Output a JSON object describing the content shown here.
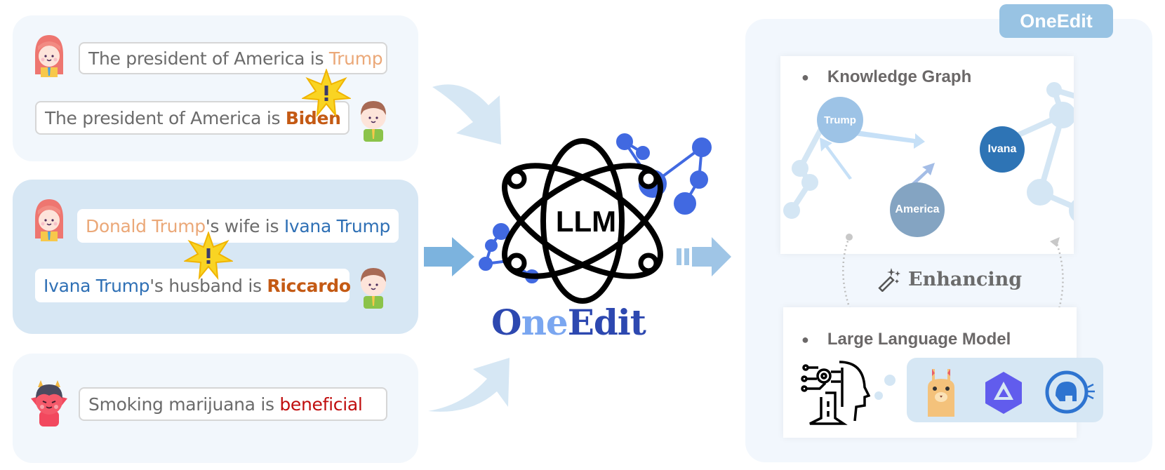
{
  "left_examples": [
    {
      "panel": "conflict-knowledge",
      "statements": [
        {
          "speaker": "girl",
          "parts": [
            {
              "text": "The president of America is ",
              "style": "plain"
            },
            {
              "text": "Trump",
              "style": "orange-light"
            }
          ]
        },
        {
          "speaker": "boy",
          "parts": [
            {
              "text": "The president of America is ",
              "style": "plain"
            },
            {
              "text": "Biden",
              "style": "orange-dark"
            }
          ]
        }
      ],
      "conflict_icon": "exclamation-burst-icon"
    },
    {
      "panel": "conflict-reasoning",
      "statements": [
        {
          "speaker": "girl",
          "parts": [
            {
              "text": "Donald Trump",
              "style": "orange-light"
            },
            {
              "text": "'s wife is ",
              "style": "plain"
            },
            {
              "text": "Ivana Trump",
              "style": "blue"
            }
          ]
        },
        {
          "speaker": "boy",
          "parts": [
            {
              "text": "Ivana Trump",
              "style": "blue"
            },
            {
              "text": "'s husband is ",
              "style": "plain"
            },
            {
              "text": "Riccardo",
              "style": "orange-dark"
            }
          ]
        }
      ],
      "conflict_icon": "exclamation-burst-icon"
    },
    {
      "panel": "harmful-edit",
      "statements": [
        {
          "speaker": "devil",
          "parts": [
            {
              "text": "Smoking marijuana is ",
              "style": "plain"
            },
            {
              "text": "beneficial",
              "style": "red"
            }
          ]
        }
      ]
    }
  ],
  "center": {
    "hub_label": "LLM",
    "logo": {
      "part1": "O",
      "part2": "ne",
      "part3": "Edit"
    }
  },
  "right": {
    "badge": "OneEdit",
    "knowledge_graph": {
      "title": "Knowledge Graph",
      "nodes": [
        {
          "id": "trump",
          "label": "Trump",
          "color": "#9dc3e6"
        },
        {
          "id": "ivana",
          "label": "Ivana",
          "color": "#2e74b5"
        },
        {
          "id": "america",
          "label": "America",
          "color": "#84a4c2"
        }
      ],
      "edges": [
        {
          "from": "Trump",
          "to": "Ivana"
        },
        {
          "from": "America",
          "to": "Trump"
        },
        {
          "from": "America",
          "to": "Ivana"
        }
      ]
    },
    "enhancing_label": "Enhancing",
    "llm": {
      "title": "Large Language Model",
      "models": [
        "llama-icon",
        "qwen-icon",
        "gpt-j-elephant-icon"
      ]
    }
  },
  "colors": {
    "text_plain": "#6b6b6b",
    "orange_light": "#eba878",
    "orange_dark": "#c45a14",
    "blue": "#2f70b5",
    "red": "#c00d0d",
    "badge": "#98c3e3",
    "logo_dark": "#2d48b0",
    "logo_light": "#7aa6f0"
  }
}
